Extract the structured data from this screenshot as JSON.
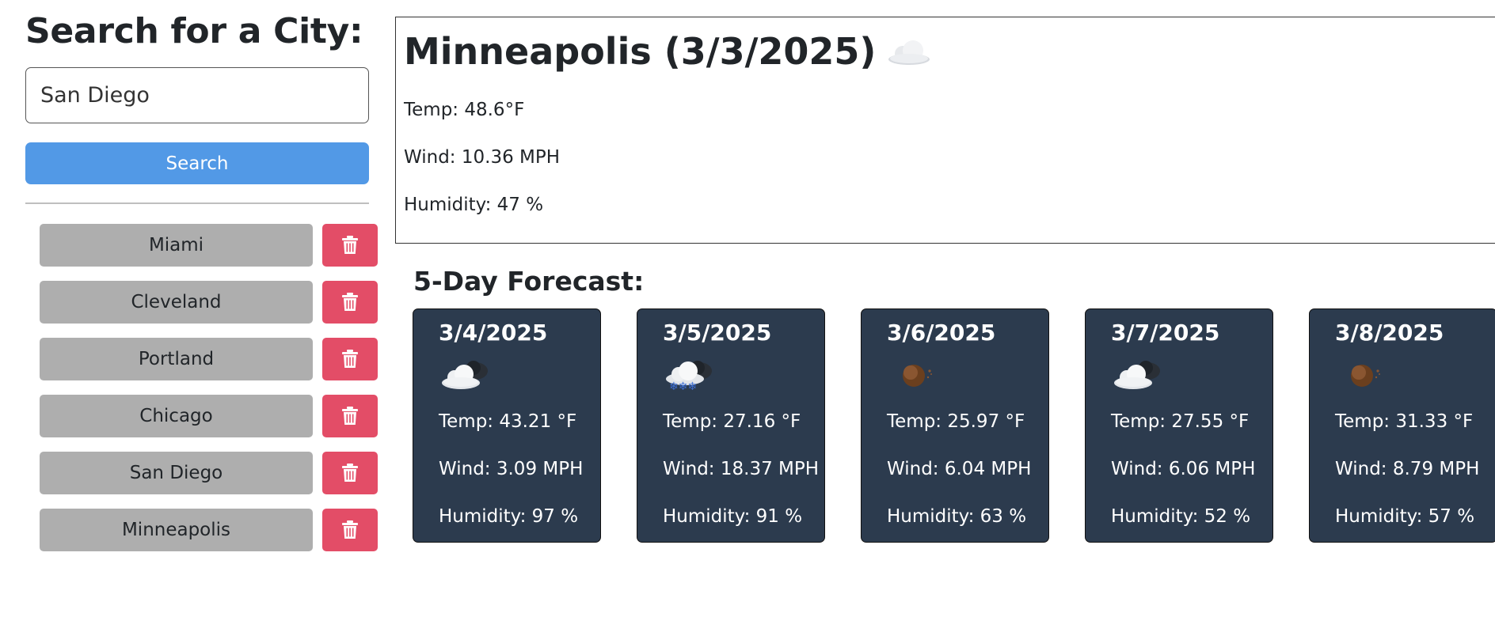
{
  "search": {
    "heading": "Search for a City:",
    "input_value": "San Diego",
    "placeholder": "",
    "button_label": "Search"
  },
  "history": [
    {
      "city": "Miami"
    },
    {
      "city": "Cleveland"
    },
    {
      "city": "Portland"
    },
    {
      "city": "Chicago"
    },
    {
      "city": "San Diego"
    },
    {
      "city": "Minneapolis"
    }
  ],
  "current": {
    "title": "Minneapolis (3/3/2025)",
    "icon": "cloud-icon",
    "temp": "Temp: 48.6°F",
    "wind": "Wind: 10.36 MPH",
    "humidity": "Humidity: 47 %"
  },
  "forecast_title": "5-Day Forecast:",
  "forecast": [
    {
      "date": "3/4/2025",
      "icon": "broken-clouds-night-icon",
      "temp": "Temp: 43.21 °F",
      "wind": "Wind: 3.09 MPH",
      "humidity": "Humidity: 97 %"
    },
    {
      "date": "3/5/2025",
      "icon": "snow-night-icon",
      "temp": "Temp: 27.16 °F",
      "wind": "Wind: 18.37 MPH",
      "humidity": "Humidity: 91 %"
    },
    {
      "date": "3/6/2025",
      "icon": "clear-night-icon",
      "temp": "Temp: 25.97 °F",
      "wind": "Wind: 6.04 MPH",
      "humidity": "Humidity: 63 %"
    },
    {
      "date": "3/7/2025",
      "icon": "broken-clouds-night-icon",
      "temp": "Temp: 27.55 °F",
      "wind": "Wind: 6.06 MPH",
      "humidity": "Humidity: 52 %"
    },
    {
      "date": "3/8/2025",
      "icon": "clear-night-icon",
      "temp": "Temp: 31.33 °F",
      "wind": "Wind: 8.79 MPH",
      "humidity": "Humidity: 57 %"
    }
  ],
  "colors": {
    "search_button": "#5299e6",
    "city_button": "#aeaeae",
    "delete_button": "#e34d67",
    "forecast_card": "#2c3b4e"
  }
}
